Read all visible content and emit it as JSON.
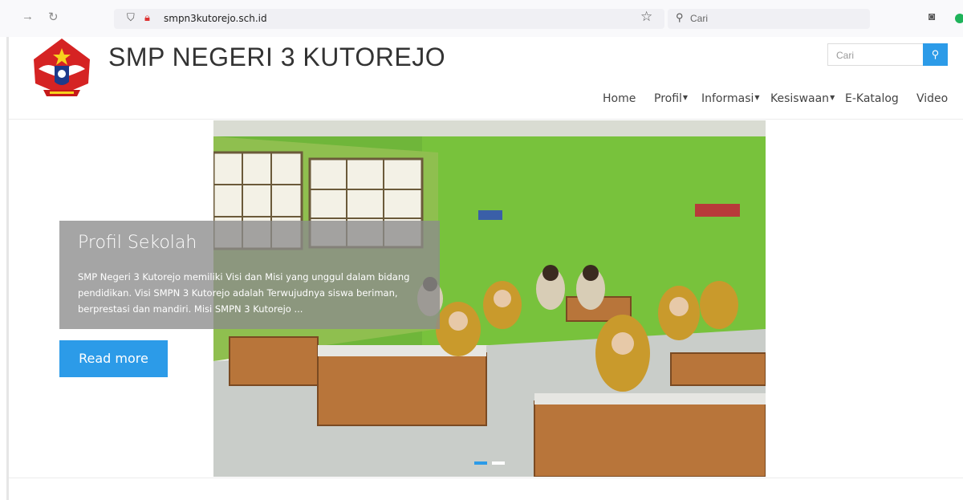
{
  "browser": {
    "back_icon": "arrow-right-icon",
    "reload_icon": "reload-icon",
    "url": "smpn3kutorejo.sch.id",
    "search_placeholder": "Cari"
  },
  "site": {
    "title": "SMP NEGERI 3 KUTOREJO",
    "search_placeholder": "Cari",
    "accent_color": "#2c9be8"
  },
  "nav": {
    "items": [
      {
        "label": "Home",
        "has_dropdown": false
      },
      {
        "label": "Profil",
        "has_dropdown": true
      },
      {
        "label": "Informasi",
        "has_dropdown": true
      },
      {
        "label": "Kesiswaan",
        "has_dropdown": true
      },
      {
        "label": "E-Katalog",
        "has_dropdown": false
      },
      {
        "label": "Video",
        "has_dropdown": false
      }
    ]
  },
  "slider": {
    "caption_title": "Profil Sekolah",
    "caption_text": "SMP Negeri 3 Kutorejo memiliki Visi dan Misi yang unggul dalam bidang pendidikan. Visi SMPN 3 Kutorejo adalah Terwujudnya siswa beriman, berprestasi dan mandiri. Misi SMPN 3 Kutorejo ...",
    "read_more_label": "Read more",
    "active_slide": 1,
    "slide_count": 2
  }
}
